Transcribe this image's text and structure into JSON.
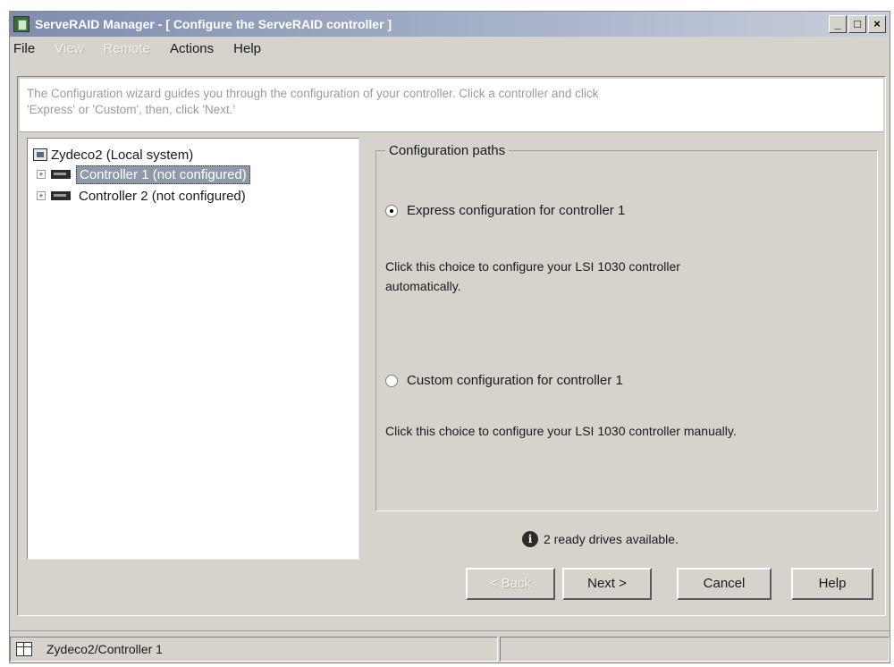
{
  "window": {
    "title": "ServeRAID Manager - [ Configure the ServeRAID controller ]",
    "controls": {
      "minimize": "_",
      "maximize": "□",
      "close": "×"
    }
  },
  "menu": {
    "file": "File",
    "view": "View",
    "remote": "Remote",
    "actions": "Actions",
    "help": "Help"
  },
  "hint": {
    "line1": "The Configuration wizard guides you through the configuration of your controller. Click a controller and click",
    "line2": "'Express' or 'Custom', then, click 'Next.'"
  },
  "tree": {
    "root": "Zydeco2 (Local system)",
    "controllers": [
      {
        "label": "Controller 1 (not configured)",
        "selected": true
      },
      {
        "label": "Controller 2 (not configured)",
        "selected": false
      }
    ]
  },
  "config": {
    "group_title": "Configuration paths",
    "express": {
      "label": "Express configuration for controller 1",
      "desc_line1": "Click this choice to configure your LSI 1030 controller",
      "desc_line2": "automatically.",
      "checked": true
    },
    "custom": {
      "label": "Custom configuration for controller 1",
      "desc": "Click this choice to configure your LSI 1030 controller manually.",
      "checked": false
    },
    "info": "2 ready drives available."
  },
  "buttons": {
    "back": "< Back",
    "next": "Next >",
    "cancel": "Cancel",
    "help": "Help"
  },
  "status": {
    "path": "Zydeco2/Controller 1"
  }
}
